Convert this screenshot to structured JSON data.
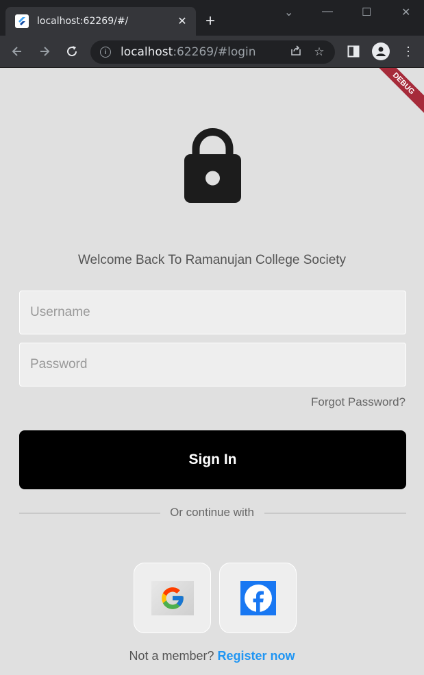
{
  "browser": {
    "tab_title": "localhost:62269/#/",
    "tab_close": "✕",
    "new_tab": "+",
    "url_host": "localhost",
    "url_path": ":62269/#login",
    "window_controls": [
      "⌄",
      "—",
      "☐",
      "✕"
    ]
  },
  "debug_banner": "DEBUG",
  "login": {
    "welcome": "Welcome Back To Ramanujan College Society",
    "username_placeholder": "Username",
    "password_placeholder": "Password",
    "forgot_password": "Forgot Password?",
    "sign_in": "Sign In",
    "divider": "Or continue with",
    "register_prompt": "Not a member?",
    "register_link": "Register now"
  },
  "colors": {
    "page_bg": "#e0e0e0",
    "button_bg": "#000000",
    "link": "#2196f3",
    "debug": "#a62b3a"
  }
}
